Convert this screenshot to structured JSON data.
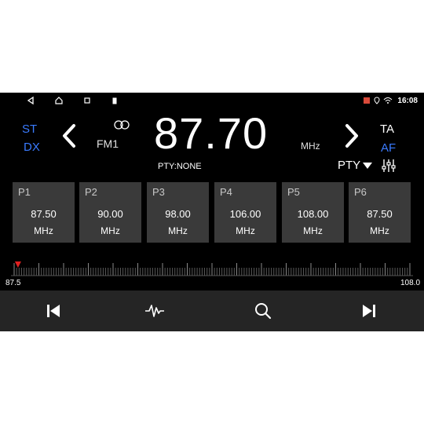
{
  "status_bar": {
    "time": "16:08",
    "nav_icons": [
      "back-icon",
      "home-icon",
      "recents-icon",
      "clipboard-icon"
    ],
    "status_icons": [
      "notification-icon",
      "location-icon",
      "wifi-icon"
    ]
  },
  "radio": {
    "st_label": "ST",
    "dx_label": "DX",
    "ta_label": "TA",
    "af_label": "AF",
    "band": "FM1",
    "frequency": "87.70",
    "unit": "MHz",
    "pty_status": "PTY:NONE",
    "pty_select": "PTY"
  },
  "presets": [
    {
      "name": "P1",
      "freq": "87.50",
      "unit": "MHz"
    },
    {
      "name": "P2",
      "freq": "90.00",
      "unit": "MHz"
    },
    {
      "name": "P3",
      "freq": "98.00",
      "unit": "MHz"
    },
    {
      "name": "P4",
      "freq": "106.00",
      "unit": "MHz"
    },
    {
      "name": "P5",
      "freq": "108.00",
      "unit": "MHz"
    },
    {
      "name": "P6",
      "freq": "87.50",
      "unit": "MHz"
    }
  ],
  "scale": {
    "min": "87.5",
    "max": "108.0",
    "pointer_freq": 87.7
  },
  "controls": [
    "skip-previous-icon",
    "waveform-icon",
    "search-icon",
    "skip-next-icon"
  ],
  "colors": {
    "accent_blue": "#3a7bff",
    "pointer_red": "#e02020",
    "preset_bg": "#3a3a3a",
    "control_bar": "#252525"
  }
}
